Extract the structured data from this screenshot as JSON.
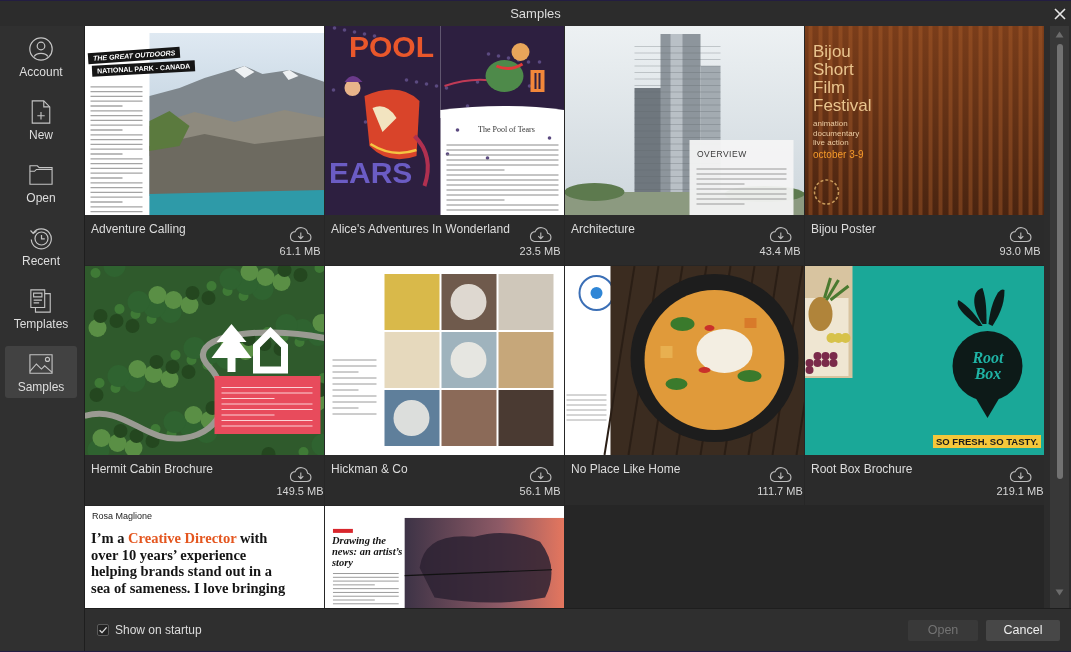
{
  "window": {
    "title": "Samples"
  },
  "sidebar": {
    "items": [
      {
        "label": "Account",
        "selected": false
      },
      {
        "label": "New",
        "selected": false
      },
      {
        "label": "Open",
        "selected": false
      },
      {
        "label": "Recent",
        "selected": false
      },
      {
        "label": "Templates",
        "selected": false
      },
      {
        "label": "Samples",
        "selected": true
      }
    ]
  },
  "samples": [
    {
      "name": "Adventure Calling",
      "size": "61.1 MB",
      "selected": false,
      "preview": {
        "kind": "outdoors",
        "texts": [
          "THE GREAT OUTDOORS",
          "NATIONAL PARK - CANADA"
        ]
      }
    },
    {
      "name": "Alice's Adventures In Wonderland",
      "size": "23.5 MB",
      "selected": false,
      "preview": {
        "kind": "book",
        "texts": [
          "POOL",
          "EARS",
          "The Pool of Tears"
        ]
      }
    },
    {
      "name": "Architecture",
      "size": "43.4 MB",
      "selected": false,
      "preview": {
        "kind": "tower",
        "texts": [
          "OVERVIEW"
        ]
      }
    },
    {
      "name": "Bijou Poster",
      "size": "93.0 MB",
      "selected": false,
      "preview": {
        "kind": "poster",
        "texts": [
          "Bijou Short Film Festival",
          "animation documentary live action",
          "october 3-9"
        ]
      }
    },
    {
      "name": "Hermit Cabin Brochure",
      "size": "149.5 MB",
      "selected": false,
      "preview": {
        "kind": "forest"
      }
    },
    {
      "name": "Hickman & Co",
      "size": "56.1 MB",
      "selected": false,
      "preview": {
        "kind": "grid"
      }
    },
    {
      "name": "No Place Like Home",
      "size": "111.7 MB",
      "selected": false,
      "preview": {
        "kind": "food"
      }
    },
    {
      "name": "Root Box Brochure",
      "size": "219.1 MB",
      "selected": false,
      "preview": {
        "kind": "beet",
        "texts": [
          "Root Box",
          "SO FRESH. SO TASTY."
        ]
      }
    },
    {
      "selected": false,
      "preview": {
        "kind": "resume",
        "texts": [
          "Rosa Maglione",
          "I’m a **Creative Director** with over 10 years’ experience helping brands stand out in a sea of sameness. I love bringing"
        ]
      }
    },
    {
      "selected": false,
      "preview": {
        "kind": "magazine",
        "texts": [
          "Drawing the news: an artist’s story"
        ]
      }
    }
  ],
  "footer": {
    "show_on_startup": {
      "label": "Show on startup",
      "checked": true
    },
    "open_button": {
      "label": "Open",
      "disabled": true
    },
    "cancel_button": {
      "label": "Cancel",
      "disabled": false
    }
  }
}
